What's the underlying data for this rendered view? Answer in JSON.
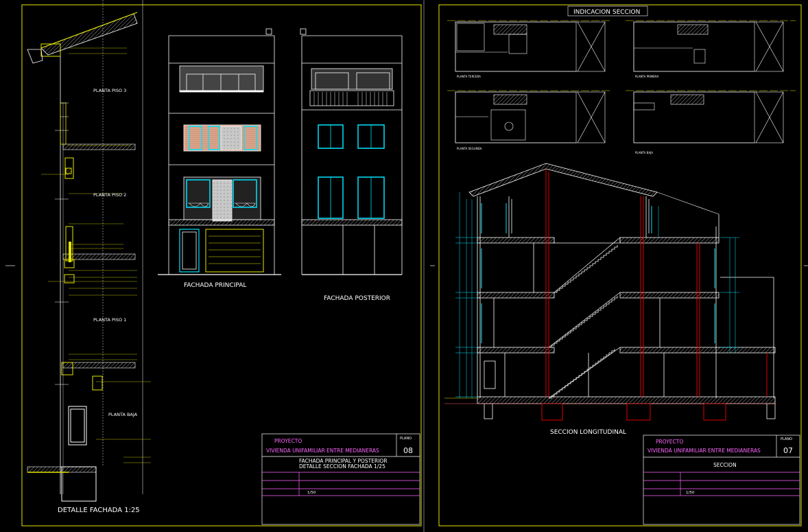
{
  "sheet_left": {
    "detail": {
      "title": "DETALLE FACHADA 1:25",
      "floors": [
        "PLANTA PISO 3",
        "PLANTA PISO 2",
        "PLANTA PISO 1",
        "PLANTA BAJA"
      ]
    },
    "elevations": {
      "front_title": "FACHADA PRINCIPAL",
      "rear_title": "FACHADA POSTERIOR"
    },
    "title_block": {
      "proyecto_label": "PROYECTO",
      "proyecto_value": "VIVIENDA UNIFAMILIAR ENTRE MEDIANERAS",
      "plano_label": "PLANO",
      "plano_number": "08",
      "drawing_title_1": "FACHADA PRINCIPAL Y POSTERIOR",
      "drawing_title_2": "DETALLE SECCION FACHADA 1/25",
      "escala_value": "1/50"
    }
  },
  "sheet_right": {
    "index_title": "INDICACION SECCION",
    "plans": [
      "PLANTA TERCERA",
      "PLANTA PRIMERA",
      "PLANTA SEGUNDA",
      "PLANTA BAJA"
    ],
    "section_title": "SECCION LONGITUDINAL",
    "title_block": {
      "proyecto_label": "PROYECTO",
      "proyecto_value": "VIVIENDA UNIFAMILIAR ENTRE MEDIANERAS",
      "plano_label": "PLANO",
      "plano_number": "07",
      "drawing_title": "SECCION",
      "escala_value": "1/50"
    }
  },
  "colors": {
    "frame": "#e6e600",
    "title_block_lines": "#ff66ff",
    "project_text": "#ff66ff",
    "window": "#00e5ff",
    "column": "#e00000",
    "line": "#ffffff"
  }
}
